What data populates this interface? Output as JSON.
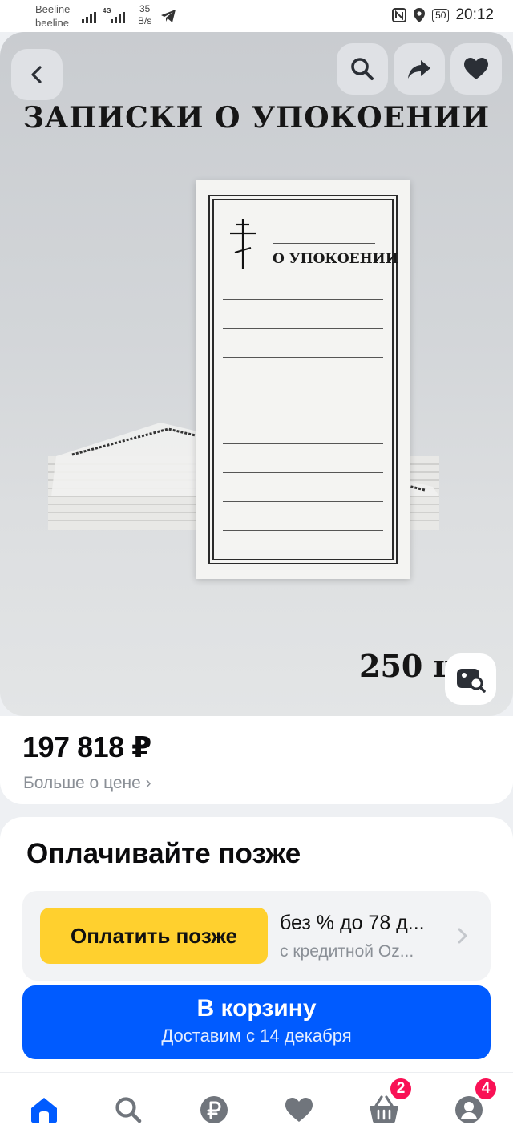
{
  "status_bar": {
    "carrier1": "Beeline",
    "carrier2": "beeline",
    "network": "4G",
    "speed": "35",
    "speed_unit": "B/s",
    "battery": "50",
    "time": "20:12"
  },
  "product": {
    "image_title": "ЗАПИСКИ О УПОКОЕНИИ",
    "card_label": "О УПОКОЕНИИ",
    "quantity_text": "250 ш"
  },
  "price": {
    "value": "197 818 ₽",
    "more_link": "Больше о цене ›"
  },
  "pay_later": {
    "title": "Оплачивайте позже",
    "button_label": "Оплатить позже",
    "line1": "без % до 78 д...",
    "line2": "с кредитной Oz..."
  },
  "cart": {
    "label": "В корзину",
    "delivery": "Доставим с 14 декабря"
  },
  "bottom_nav": {
    "cart_badge": "2",
    "profile_badge": "4"
  },
  "colors": {
    "accent": "#005bff",
    "pay_later": "#ffd02e",
    "badge": "#f91155"
  }
}
